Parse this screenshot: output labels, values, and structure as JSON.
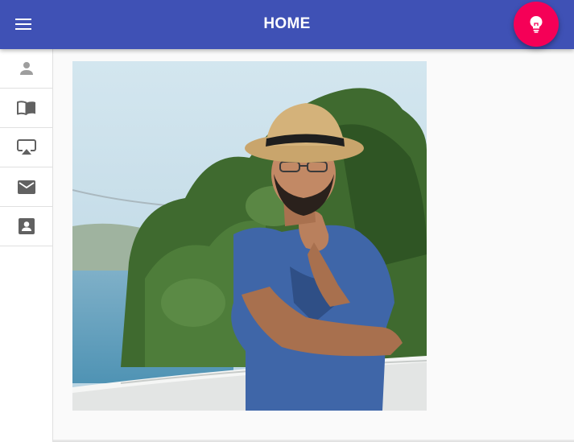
{
  "app": {
    "title": "HOME",
    "accent_color": "#3f51b5",
    "fab_color": "#f50057"
  },
  "header": {
    "menu_icon": "menu-icon",
    "fab_icon": "lightbulb-icon"
  },
  "sidebar": {
    "items": [
      {
        "icon": "person-icon"
      },
      {
        "icon": "book-icon"
      },
      {
        "icon": "airplay-icon"
      },
      {
        "icon": "mail-icon"
      },
      {
        "icon": "contact-card-icon"
      }
    ]
  },
  "main": {
    "image": "portrait-photo"
  }
}
